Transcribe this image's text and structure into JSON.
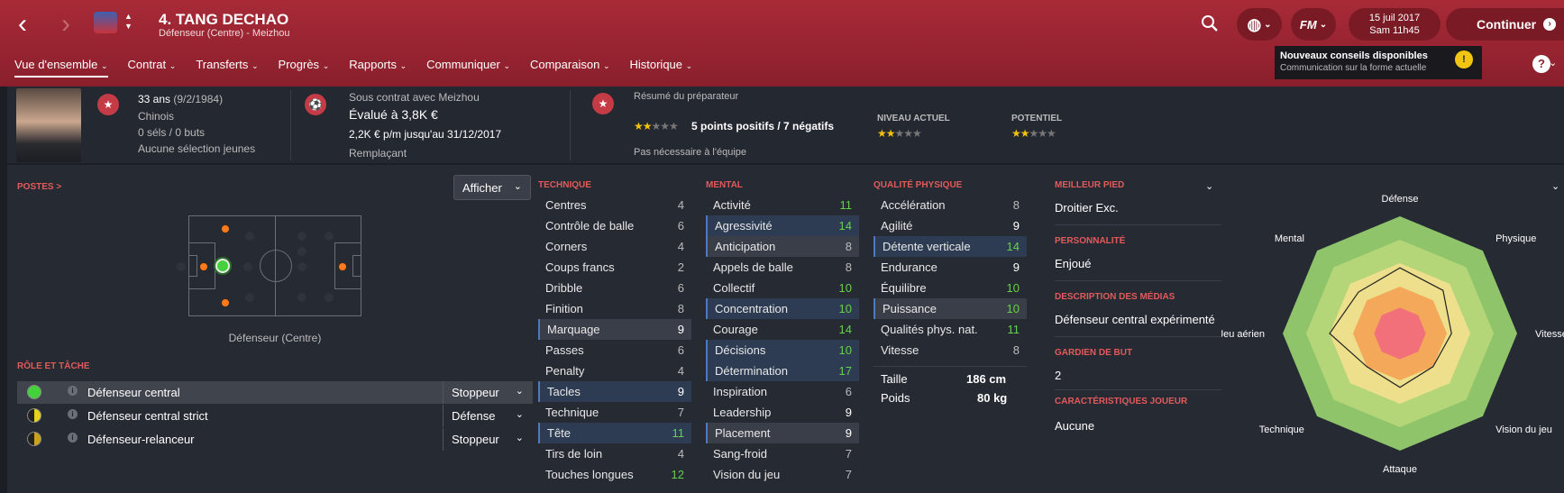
{
  "header": {
    "title": "4. TANG DECHAO",
    "subtitle": "Défenseur (Centre) - Meizhou",
    "date": "15 juil 2017",
    "time": "Sam 11h45",
    "continue_label": "Continuer",
    "fm_label": "FM"
  },
  "nav": [
    "Vue d'ensemble",
    "Contrat",
    "Transferts",
    "Progrès",
    "Rapports",
    "Communiquer",
    "Comparaison",
    "Historique"
  ],
  "tip": {
    "title": "Nouveaux conseils disponibles",
    "text": "Communication sur la forme actuelle",
    "bulb": "!"
  },
  "info": {
    "age": "33 ans",
    "dob": "(9/2/1984)",
    "nationality": "Chinois",
    "caps": "0 séls / 0 buts",
    "youth": "Aucune sélection jeunes",
    "contract": "Sous contrat avec Meizhou",
    "value": "Évalué à 3,8K €",
    "wage": "2,2K € p/m jusqu'au 31/12/2017",
    "status": "Remplaçant",
    "coach_title": "Résumé du préparateur",
    "coach_summary": "5 points positifs / 7 négatifs",
    "coach_note": "Pas nécessaire à l'équipe",
    "current_label": "NIVEAU ACTUEL",
    "potential_label": "POTENTIEL",
    "coach_stars": 1.5,
    "current_stars": 1.5,
    "potential_stars": 1.5
  },
  "positions": {
    "title": "POSTES >",
    "afficher": "Afficher",
    "label": "Défenseur (Centre)"
  },
  "roles": {
    "title": "RÔLE ET TÂCHE",
    "items": [
      {
        "name": "Défenseur central",
        "duty": "Stoppeur"
      },
      {
        "name": "Défenseur central strict",
        "duty": "Défense"
      },
      {
        "name": "Défenseur-relanceur",
        "duty": "Stoppeur"
      }
    ]
  },
  "technique": {
    "title": "TECHNIQUE",
    "attrs": [
      {
        "name": "Centres",
        "value": "4"
      },
      {
        "name": "Contrôle de balle",
        "value": "6"
      },
      {
        "name": "Corners",
        "value": "4"
      },
      {
        "name": "Coups francs",
        "value": "2"
      },
      {
        "name": "Dribble",
        "value": "6"
      },
      {
        "name": "Finition",
        "value": "8"
      },
      {
        "name": "Marquage",
        "value": "9"
      },
      {
        "name": "Passes",
        "value": "6"
      },
      {
        "name": "Penalty",
        "value": "4"
      },
      {
        "name": "Tacles",
        "value": "9"
      },
      {
        "name": "Technique",
        "value": "7"
      },
      {
        "name": "Tête",
        "value": "11"
      },
      {
        "name": "Tirs de loin",
        "value": "4"
      },
      {
        "name": "Touches longues",
        "value": "12"
      }
    ]
  },
  "mental": {
    "title": "MENTAL",
    "attrs": [
      {
        "name": "Activité",
        "value": "11"
      },
      {
        "name": "Agressivité",
        "value": "14"
      },
      {
        "name": "Anticipation",
        "value": "8"
      },
      {
        "name": "Appels de balle",
        "value": "8"
      },
      {
        "name": "Collectif",
        "value": "10"
      },
      {
        "name": "Concentration",
        "value": "10"
      },
      {
        "name": "Courage",
        "value": "14"
      },
      {
        "name": "Décisions",
        "value": "10"
      },
      {
        "name": "Détermination",
        "value": "17"
      },
      {
        "name": "Inspiration",
        "value": "6"
      },
      {
        "name": "Leadership",
        "value": "9"
      },
      {
        "name": "Placement",
        "value": "9"
      },
      {
        "name": "Sang-froid",
        "value": "7"
      },
      {
        "name": "Vision du jeu",
        "value": "7"
      }
    ]
  },
  "physical": {
    "title": "QUALITÉ PHYSIQUE",
    "attrs": [
      {
        "name": "Accélération",
        "value": "8"
      },
      {
        "name": "Agilité",
        "value": "9"
      },
      {
        "name": "Détente verticale",
        "value": "14"
      },
      {
        "name": "Endurance",
        "value": "9"
      },
      {
        "name": "Équilibre",
        "value": "10"
      },
      {
        "name": "Puissance",
        "value": "10"
      },
      {
        "name": "Qualités phys. nat.",
        "value": "11"
      },
      {
        "name": "Vitesse",
        "value": "8"
      }
    ],
    "height_label": "Taille",
    "height": "186 cm",
    "weight_label": "Poids",
    "weight": "80 kg"
  },
  "details": {
    "foot_title": "MEILLEUR PIED",
    "foot": "Droitier Exc.",
    "personality_title": "PERSONNALITÉ",
    "personality": "Enjoué",
    "media_title": "DESCRIPTION DES MÉDIAS",
    "media": "Défenseur central expérimenté",
    "gk_title": "GARDIEN DE BUT",
    "gk": "2",
    "traits_title": "CARACTÉRISTIQUES JOUEUR",
    "traits": "Aucune"
  },
  "radar": {
    "labels": [
      "Défense",
      "Physique",
      "Vitesse",
      "Vision du jeu",
      "Attaque",
      "Technique",
      "Jeu aérien",
      "Mental"
    ],
    "values": [
      0.56,
      0.52,
      0.44,
      0.4,
      0.46,
      0.4,
      0.6,
      0.5
    ]
  },
  "colors": {
    "accent": "#a82a37",
    "green_value": "#66d04c",
    "section_title": "#e25a5a"
  }
}
